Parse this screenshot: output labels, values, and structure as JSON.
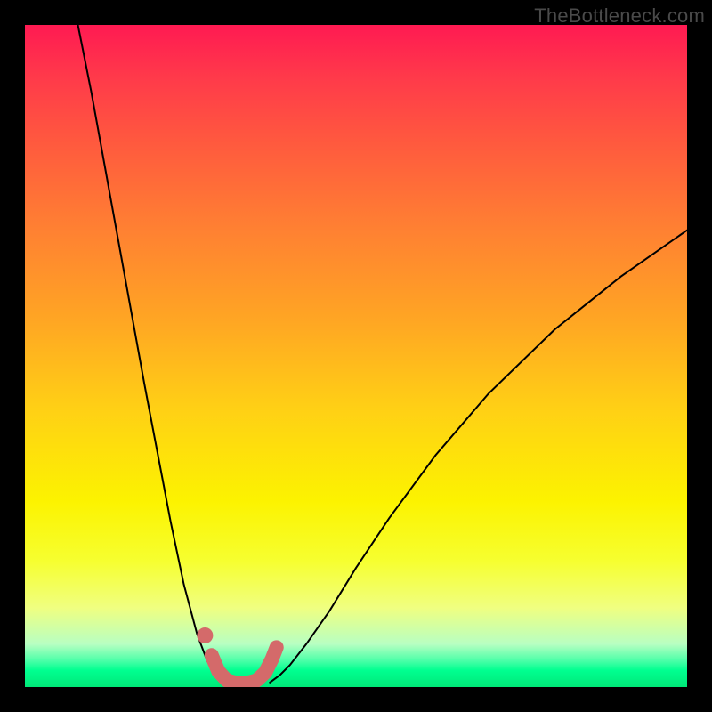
{
  "watermark": "TheBottleneck.com",
  "chart_data": {
    "type": "line",
    "title": "",
    "xlabel": "",
    "ylabel": "",
    "xlim": [
      0,
      100
    ],
    "ylim": [
      0,
      100
    ],
    "curves": {
      "left": {
        "name": "left-curve",
        "color": "#000000",
        "stroke_width": 2,
        "x": [
          8,
          10,
          12,
          14,
          16,
          18,
          20,
          22,
          24,
          26,
          27.5,
          29,
          30
        ],
        "y": [
          100,
          90,
          79,
          68,
          57,
          46,
          35.5,
          25,
          15.5,
          8,
          4,
          1.5,
          0.5
        ]
      },
      "right": {
        "name": "right-curve",
        "color": "#000000",
        "stroke_width": 2,
        "x": [
          37,
          38.5,
          40,
          42.5,
          46,
          50,
          55,
          62,
          70,
          80,
          90,
          100
        ],
        "y": [
          0.7,
          1.8,
          3.3,
          6.5,
          11.5,
          18,
          25.5,
          35,
          44.3,
          54,
          62,
          69
        ]
      },
      "valley": {
        "name": "valley-highlight",
        "color": "#d46a6a",
        "stroke_width": 16,
        "x": [
          28.2,
          29.2,
          30.5,
          32,
          33.5,
          35,
          36.3,
          37.3,
          38.0
        ],
        "y": [
          4.8,
          2.4,
          1.0,
          0.6,
          0.6,
          1.0,
          2.2,
          4.2,
          6.0
        ]
      },
      "dot": {
        "name": "valley-start-dot",
        "color": "#d46a6a",
        "x": 27.2,
        "y": 7.8,
        "r": 9
      }
    },
    "background_gradient": {
      "top": "#ff1a52",
      "upper_mid": "#ffa424",
      "mid": "#fcf300",
      "lower_mid": "#f0ff80",
      "bottom": "#00e878"
    }
  }
}
